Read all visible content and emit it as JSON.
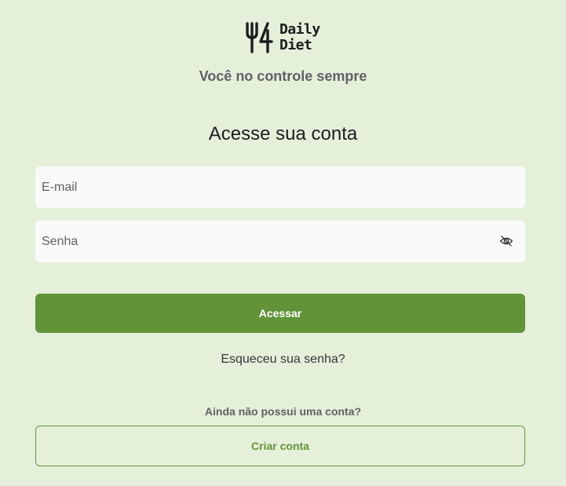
{
  "brand": {
    "line1": "Daily",
    "line2": "Diet",
    "icon": "fork-four-logo-icon"
  },
  "tagline": "Você no controle sempre",
  "form": {
    "title": "Acesse sua conta",
    "email": {
      "placeholder": "E-mail",
      "value": ""
    },
    "password": {
      "placeholder": "Senha",
      "value": "",
      "toggle_icon": "eye-off-icon"
    },
    "submit_label": "Acessar",
    "forgot_label": "Esqueceu sua senha?"
  },
  "signup": {
    "prompt": "Ainda não possui uma conta?",
    "button_label": "Criar conta"
  },
  "colors": {
    "background": "#E5F0DB",
    "primary": "#639339",
    "field_bg": "#FAFAFA",
    "text_dark": "#1B1D1E",
    "text_muted": "#5C6265"
  }
}
